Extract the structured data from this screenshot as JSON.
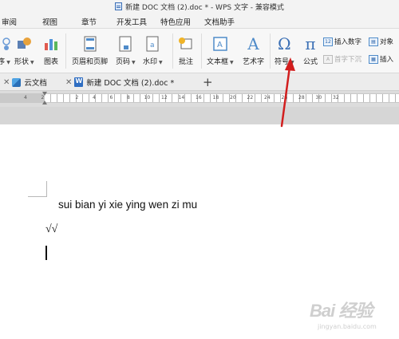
{
  "window": {
    "title": "新建 DOC 文档 (2).doc * - WPS 文字 - 兼容模式"
  },
  "menu": {
    "tabs": [
      "审阅",
      "视图",
      "章节",
      "开发工具",
      "特色应用",
      "文档助手"
    ]
  },
  "ribbon": {
    "buttons": {
      "partial": "序",
      "shape": "形状",
      "chart": "图表",
      "header_footer": "页眉和页脚",
      "page_number": "页码",
      "watermark": "水印",
      "comment": "批注",
      "textbox": "文本框",
      "wordart": "艺术字",
      "symbol": "符号",
      "formula": "公式"
    },
    "small": {
      "insert_number": "插入数字",
      "object": "对象",
      "drop_cap": "首字下沉",
      "insert_partial": "插入"
    },
    "glyphs": {
      "symbol": "Ω",
      "formula": "π",
      "wordart": "A"
    }
  },
  "doc_tabs": [
    {
      "label": "云文档"
    },
    {
      "label": "新建 DOC 文档 (2).doc *"
    }
  ],
  "document": {
    "lines": [
      "sui bian yi xie ying wen zi mu",
      "√√"
    ]
  },
  "watermark": {
    "logo": "Bai 经验",
    "url": "jingyan.baidu.com"
  },
  "colors": {
    "arrow": "#d21e1e",
    "accent": "#2f6ec2"
  }
}
